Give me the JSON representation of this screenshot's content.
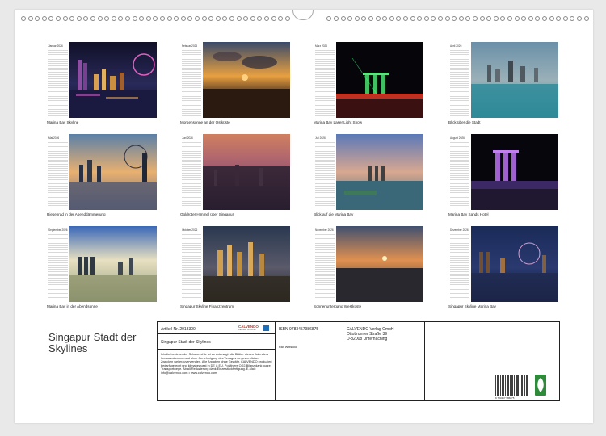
{
  "months": [
    {
      "name": "Januar 2026",
      "caption": "Marina Bay Skyline"
    },
    {
      "name": "Februar 2026",
      "caption": "Morgensonne an der Ostküste"
    },
    {
      "name": "März 2026",
      "caption": "Marina Bay Laser Light Show"
    },
    {
      "name": "April 2026",
      "caption": "Blick über die Stadt"
    },
    {
      "name": "Mai 2026",
      "caption": "Riesenrad in der Abenddämmerung"
    },
    {
      "name": "Juni 2026",
      "caption": "Goldroter Himmel über Singapur"
    },
    {
      "name": "Juli 2026",
      "caption": "Blick auf die Marina Bay"
    },
    {
      "name": "August 2026",
      "caption": "Marina Bay Sands Hotel"
    },
    {
      "name": "September 2026",
      "caption": "Marina Bay in der Abendsonne"
    },
    {
      "name": "Oktober 2026",
      "caption": "Singapur Skyline Finanzzentrum"
    },
    {
      "name": "November 2026",
      "caption": "Sonnenuntergang Westküste"
    },
    {
      "name": "Dezember 2026",
      "caption": "Singapur Skyline Marina Bay"
    }
  ],
  "title": "Singapur Stadt der Skylines",
  "info": {
    "article": "Artikel-Nr. 2013300",
    "calendar_title": "Singapur Stadt der Skylines",
    "legal": "Inhalte bestehender Schutzrechte ist es untersagt, die Blätter dieses Kalenders herauszutrennen und ohne Genehmigung des Verlages zu gewerblichen Zwecken weiterzuverwenden. Alle Angaben ohne Gewähr. CALVENDO produziert bedarfsgerecht und klimabewusst in DE & EU. Positivere CO2-Bilanz dank kurzer Transportwege. Abfall-Reduzierung dank Einzelstückfertigung. E-Mail: info@calvendo.com • www.calvendo.com",
    "isbn": "ISBN 9783457986875",
    "author": "Ralf Wittstock",
    "publisher": "CALVENDO Verlag GmbH",
    "street": "Ottobrunner Straße 39",
    "city": "D-82008 Unterhaching",
    "barcode_number": "9 783457 986875",
    "logo_name": "CALVENDO",
    "logo_sub": "Kalender & Bücher"
  }
}
